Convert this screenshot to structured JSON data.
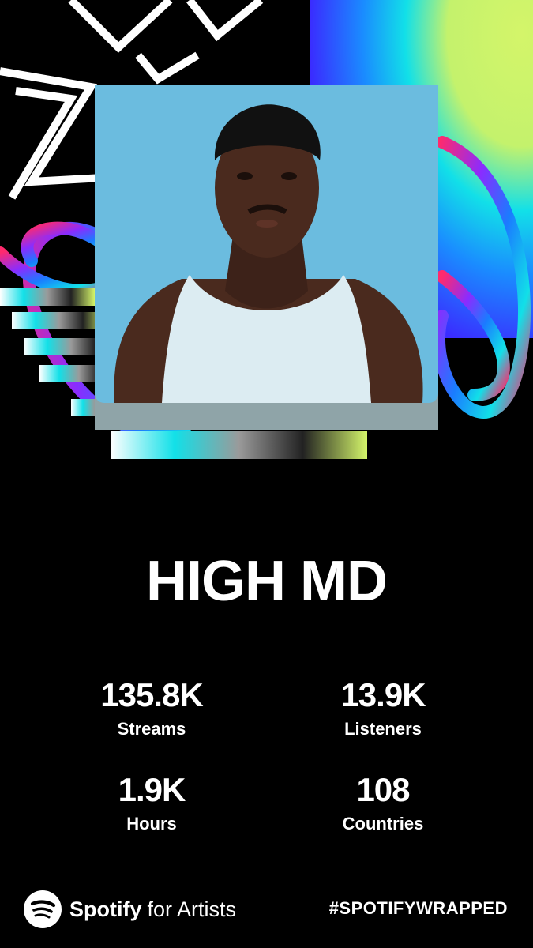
{
  "artist": {
    "name": "HIGH MD"
  },
  "stats": [
    {
      "value": "135.8K",
      "label": "Streams"
    },
    {
      "value": "13.9K",
      "label": "Listeners"
    },
    {
      "value": "1.9K",
      "label": "Hours"
    },
    {
      "value": "108",
      "label": "Countries"
    }
  ],
  "footer": {
    "brand": "Spotify",
    "brand_suffix": "for Artists",
    "hashtag": "#SPOTIFYWRAPPED",
    "logo_icon": "spotify-logo-icon"
  },
  "colors": {
    "background": "#000000",
    "portrait_bg": "#6bbcdf",
    "accent_lime": "#d4f56a",
    "accent_blue": "#2c4bff"
  }
}
